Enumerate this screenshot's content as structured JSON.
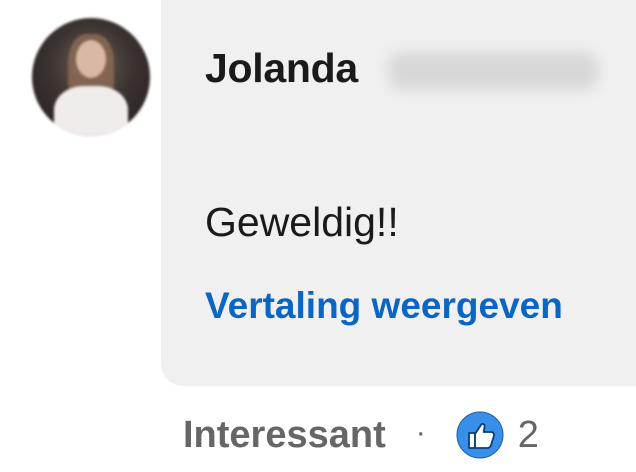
{
  "comment": {
    "author_first_name": "Jolanda",
    "text": "Geweldig!!",
    "translate_label": "Vertaling weergeven"
  },
  "actions": {
    "react_label": "Interessant",
    "separator": "·",
    "reaction_icon": "like-thumbs-up-icon",
    "reaction_count": "2"
  },
  "colors": {
    "link": "#0a66c2",
    "like_badge": "#378fe9",
    "bubble_bg": "#f0f0f0",
    "muted_text": "#666666"
  }
}
